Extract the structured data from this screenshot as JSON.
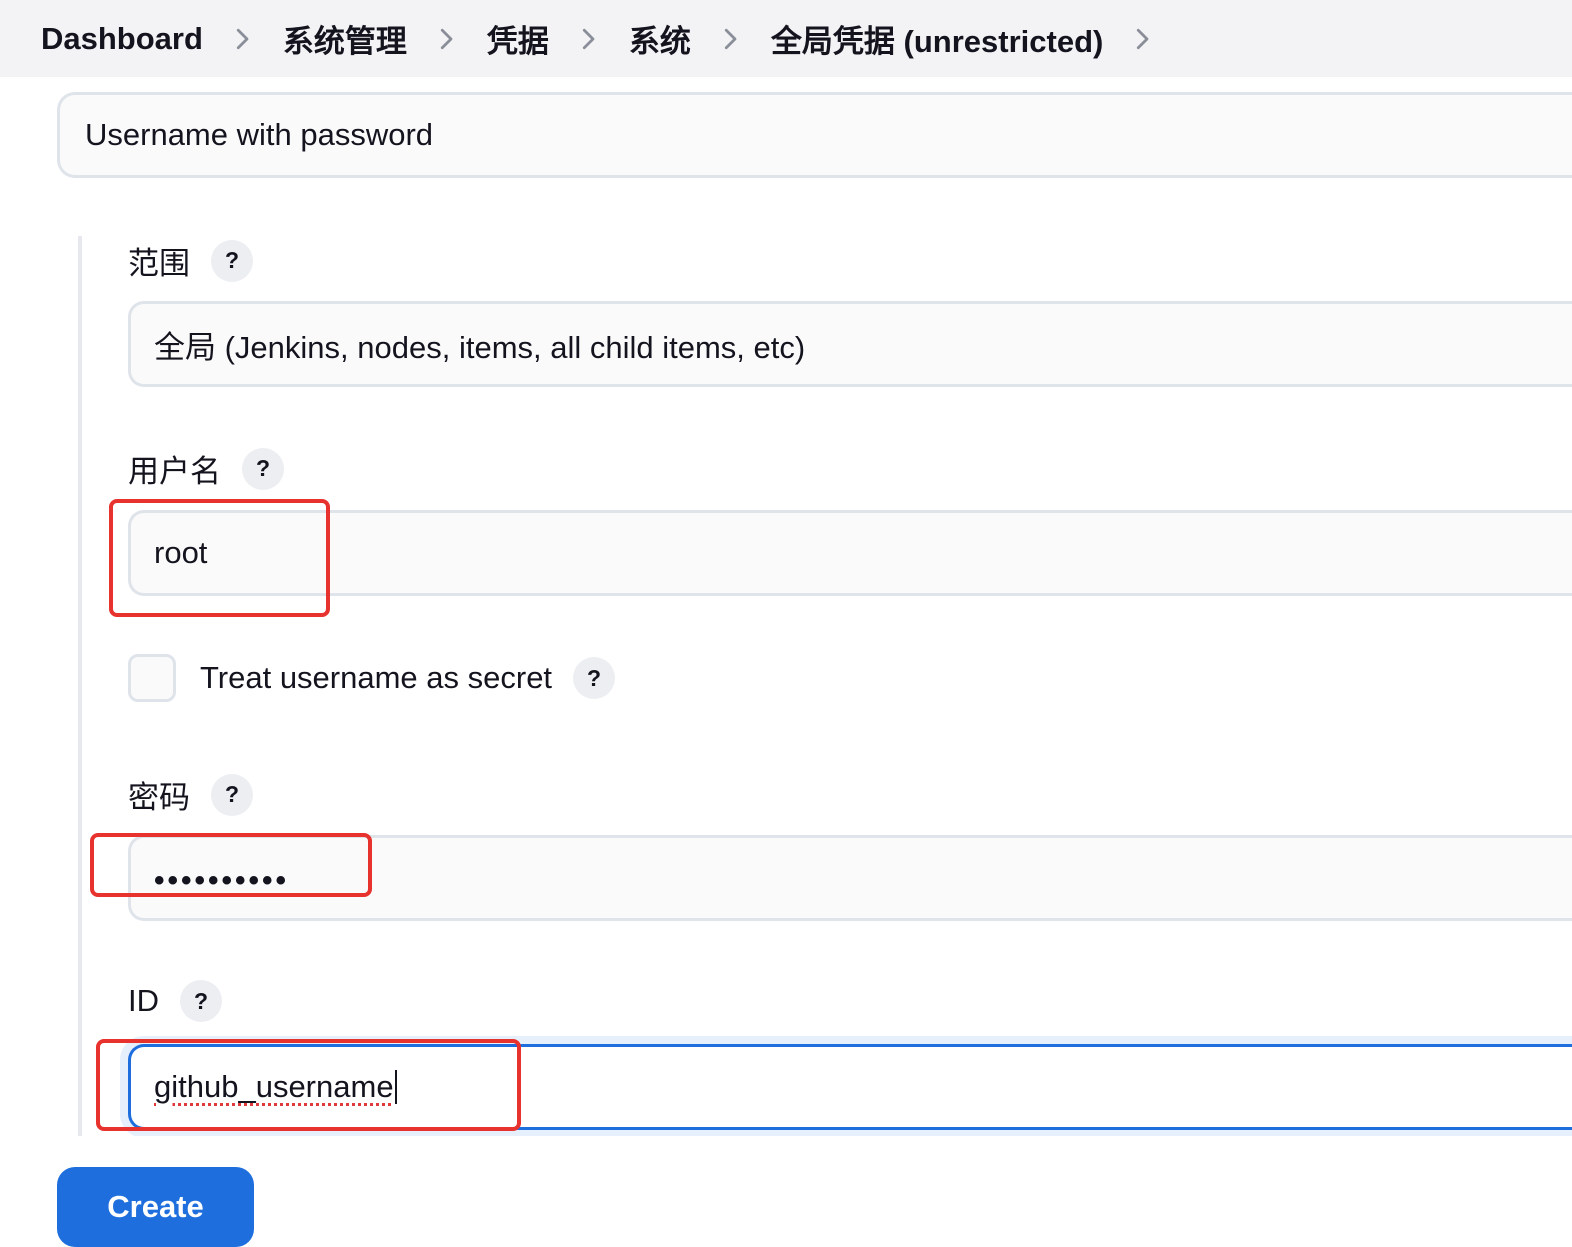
{
  "breadcrumb": [
    "Dashboard",
    "系统管理",
    "凭据",
    "系统",
    "全局凭据 (unrestricted)"
  ],
  "kind": {
    "value": "Username with password"
  },
  "scope": {
    "label": "范围",
    "help": "?",
    "value": "全局 (Jenkins, nodes, items, all child items, etc)"
  },
  "username": {
    "label": "用户名",
    "help": "?",
    "value": "root"
  },
  "treat_secret": {
    "label": "Treat username as secret",
    "help": "?",
    "checked": false
  },
  "password": {
    "label": "密码",
    "help": "?",
    "value": "••••••••••"
  },
  "id": {
    "label": "ID",
    "help": "?",
    "value": "github_username"
  },
  "create_label": "Create",
  "colors": {
    "accent": "#1e6fdd",
    "highlight": "#e8322d",
    "breadcrumb_bg": "#f3f3f5"
  }
}
